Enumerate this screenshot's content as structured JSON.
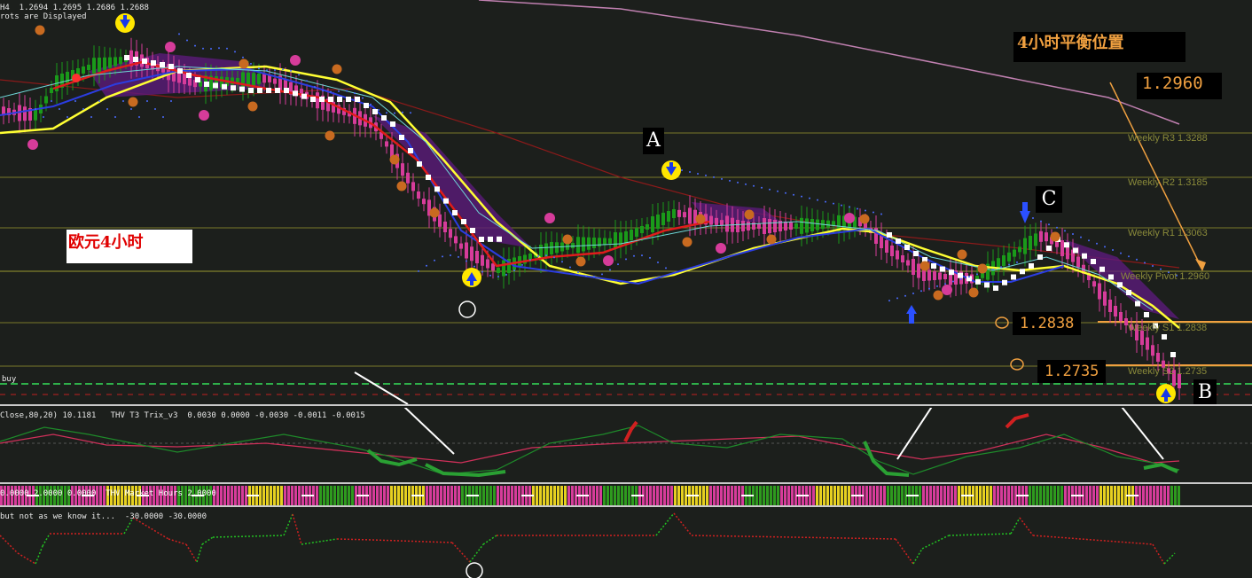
{
  "header": {
    "ohlc": "H4  1.2694 1.2695 1.2686 1.2688",
    "status": "rots are Displayed"
  },
  "annotations": {
    "balance_title": "4小时平衡位置",
    "pair_label": "欧元4小时",
    "price_top": "1.2960",
    "price_s1": "1.2838",
    "price_s2": "1.2735",
    "letter_a": "A",
    "letter_b": "B",
    "letter_c": "C"
  },
  "pivots": {
    "r3": "Weekly R3 1.3288",
    "r2": "Weekly R2 1.3185",
    "r1": "Weekly R1 1.3063",
    "pivot": "Weekly Pivot 1.2960",
    "s1": "Weekly S1 1.2838",
    "s2": "Weekly S2 1.2735"
  },
  "signal_label": "buy",
  "indicators": {
    "trix_header": "Close,80,20) 10.1181   THV T3 Trix_v3  0.0030 0.0000 -0.0030 -0.0011 -0.0015",
    "market_header": "0.0000 2.0000 0.0000  THV Market Hours 2.0000",
    "step_header": "but not as we know it...  -30.0000 -30.0000"
  },
  "colors": {
    "background": "#1c1f1c",
    "bull_candle": "#1a9a1a",
    "bear_candle": "#d63c9a",
    "pivot_line": "#7a7a2a",
    "fast_ma": "#ffff33",
    "slow_ma": "#2b3de0",
    "accent_orange": "#f0a040"
  }
}
